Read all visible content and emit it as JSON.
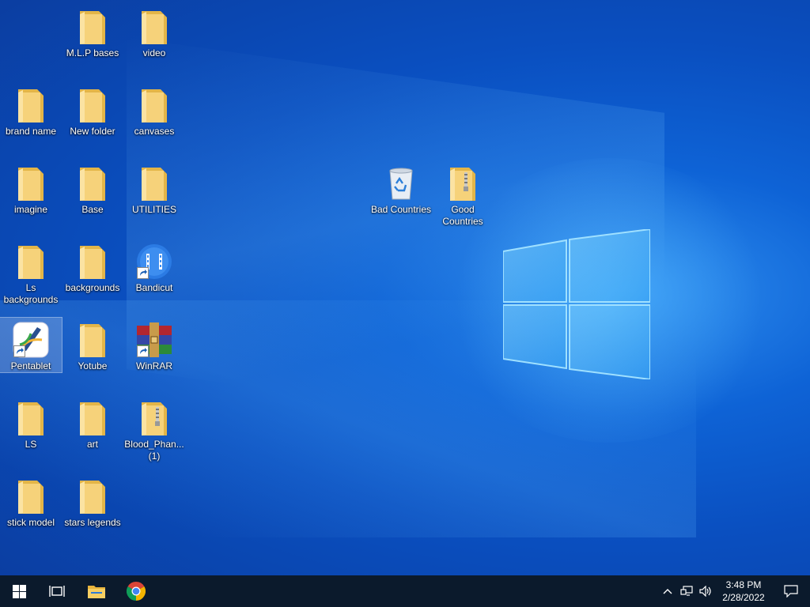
{
  "desktop": {
    "icons": [
      {
        "label": "M.L.P bases",
        "type": "folder"
      },
      {
        "label": "video",
        "type": "folder"
      },
      {
        "label": "brand name",
        "type": "folder"
      },
      {
        "label": "New folder",
        "type": "folder"
      },
      {
        "label": "canvases",
        "type": "folder"
      },
      {
        "label": "imagine",
        "type": "folder"
      },
      {
        "label": "Base",
        "type": "folder"
      },
      {
        "label": "UTILITIES",
        "type": "folder"
      },
      {
        "label": "Ls backgrounds",
        "type": "folder"
      },
      {
        "label": "backgrounds",
        "type": "folder"
      },
      {
        "label": "Bandicut",
        "type": "app-shortcut"
      },
      {
        "label": "Pentablet",
        "type": "app-shortcut",
        "selected": true
      },
      {
        "label": "Yotube",
        "type": "folder"
      },
      {
        "label": "WinRAR",
        "type": "app-shortcut"
      },
      {
        "label": "LS",
        "type": "folder"
      },
      {
        "label": "art",
        "type": "folder"
      },
      {
        "label": "Blood_Phan... (1)",
        "type": "zip-folder"
      },
      {
        "label": "stick model",
        "type": "folder"
      },
      {
        "label": "stars legends",
        "type": "folder"
      },
      {
        "label": "Bad Countries",
        "type": "recycle-bin"
      },
      {
        "label": "Good Countries",
        "type": "zip-folder"
      }
    ]
  },
  "taskbar": {
    "buttons": [
      {
        "name": "start-button",
        "icon": "windows-icon"
      },
      {
        "name": "task-view-button",
        "icon": "task-view-icon"
      },
      {
        "name": "file-explorer-button",
        "icon": "folder-icon"
      },
      {
        "name": "chrome-button",
        "icon": "chrome-icon"
      }
    ],
    "tray": {
      "chevron_icon": "chevron-up-icon",
      "network_icon": "network-icon",
      "volume_icon": "volume-icon",
      "time": "3:48 PM",
      "date": "2/28/2022",
      "notification_icon": "notification-icon"
    }
  },
  "colors": {
    "folder": "#f6d27a",
    "folder_dark": "#e3b548",
    "taskbar": "#0b1a2c"
  }
}
